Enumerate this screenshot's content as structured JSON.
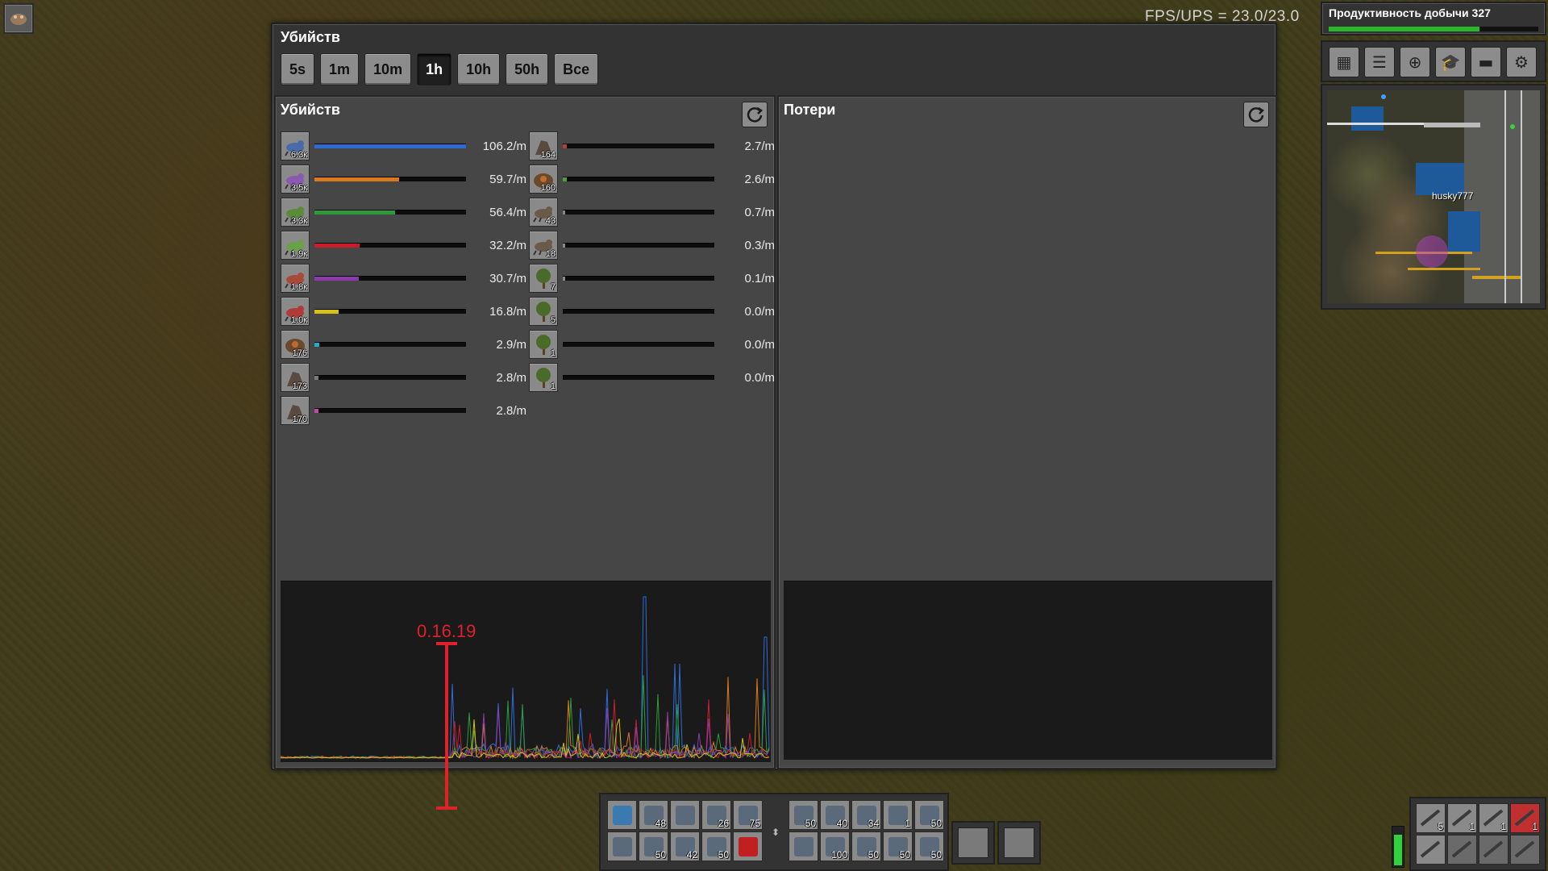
{
  "fps_text": "FPS/UPS = 23.0/23.0",
  "window": {
    "title": "Убийств",
    "tabs": [
      "5s",
      "1m",
      "10m",
      "1h",
      "10h",
      "50h",
      "Все"
    ],
    "active_tab": "1h"
  },
  "kills_panel": {
    "title": "Убийств",
    "left_column": [
      {
        "icon": "small-biter-icon",
        "count": "6.3к",
        "rate": "106.2/m",
        "color": "#2f6bd6",
        "fraction": 1.0
      },
      {
        "icon": "medium-biter-icon",
        "count": "3.5к",
        "rate": "59.7/m",
        "color": "#d9781e",
        "fraction": 0.56
      },
      {
        "icon": "small-spitter-icon",
        "count": "3.3к",
        "rate": "56.4/m",
        "color": "#2e9a3a",
        "fraction": 0.53
      },
      {
        "icon": "medium-spitter-icon",
        "count": "1.9к",
        "rate": "32.2/m",
        "color": "#c81e2a",
        "fraction": 0.3
      },
      {
        "icon": "big-biter-icon",
        "count": "1.8к",
        "rate": "30.7/m",
        "color": "#8a3aa8",
        "fraction": 0.29
      },
      {
        "icon": "big-spitter-icon",
        "count": "1.0к",
        "rate": "16.8/m",
        "color": "#d4c018",
        "fraction": 0.16
      },
      {
        "icon": "biter-spawner-icon",
        "count": "176",
        "rate": "2.9/m",
        "color": "#20b0c8",
        "fraction": 0.03
      },
      {
        "icon": "rock-icon",
        "count": "173",
        "rate": "2.8/m",
        "color": "#7a7a7a",
        "fraction": 0.025
      },
      {
        "icon": "rock-icon",
        "count": "170",
        "rate": "2.8/m",
        "color": "#c04aa8",
        "fraction": 0.025
      }
    ],
    "right_column": [
      {
        "icon": "huge-rock-icon",
        "count": "164",
        "rate": "2.7/m",
        "color": "#b04040",
        "fraction": 0.025
      },
      {
        "icon": "spitter-spawner-icon",
        "count": "160",
        "rate": "2.6/m",
        "color": "#50a030",
        "fraction": 0.025
      },
      {
        "icon": "behemoth-biter-icon",
        "count": "43",
        "rate": "0.7/m",
        "color": "#888888",
        "fraction": 0.007
      },
      {
        "icon": "small-worm-icon",
        "count": "18",
        "rate": "0.3/m",
        "color": "#888888",
        "fraction": 0.003
      },
      {
        "icon": "tree-icon",
        "count": "7",
        "rate": "0.1/m",
        "color": "#888888",
        "fraction": 0.001
      },
      {
        "icon": "dead-tree-icon",
        "count": "5",
        "rate": "0.0/m",
        "color": "#888888",
        "fraction": 0
      },
      {
        "icon": "dry-tree-icon",
        "count": "1",
        "rate": "0.0/m",
        "color": "#888888",
        "fraction": 0
      },
      {
        "icon": "dry-tree-icon",
        "count": "1",
        "rate": "0.0/m",
        "color": "#888888",
        "fraction": 0
      }
    ]
  },
  "losses_panel": {
    "title": "Потери"
  },
  "annotation": {
    "label": "0.16.19",
    "color": "#e0202a"
  },
  "hud": {
    "mining_productivity_label": "Продуктивность добычи 327",
    "mining_progress": 0.72,
    "buttons": [
      "map-icon",
      "production-stats-icon",
      "bonus-icon",
      "research-icon",
      "train-icon",
      "achievements-icon"
    ],
    "player_name": "husky777"
  },
  "quickbar": {
    "row1_a": [
      {
        "icon": "blueprint-icon",
        "count": ""
      },
      {
        "icon": "inserter-icon",
        "count": "48"
      },
      {
        "icon": "lamp-icon",
        "count": ""
      },
      {
        "icon": "assembler-icon",
        "count": "26"
      },
      {
        "icon": "repair-pack-icon",
        "count": "75"
      }
    ],
    "row2_a": [
      {
        "icon": "belt-icon",
        "count": ""
      },
      {
        "icon": "pump-icon",
        "count": "50"
      },
      {
        "icon": "roboport-icon",
        "count": "42"
      },
      {
        "icon": "turret-icon",
        "count": "50"
      },
      {
        "icon": "wall-icon",
        "count": ""
      }
    ],
    "row1_b": [
      {
        "icon": "chest-icon",
        "count": "50"
      },
      {
        "icon": "red-chest-icon",
        "count": "40"
      },
      {
        "icon": "purple-chest-icon",
        "count": "34"
      },
      {
        "icon": "robot-icon",
        "count": "1"
      },
      {
        "icon": "rail-icon",
        "count": "50"
      }
    ],
    "row2_b": [
      {
        "icon": "radar-icon",
        "count": ""
      },
      {
        "icon": "roboport-icon",
        "count": "100"
      },
      {
        "icon": "solar-icon",
        "count": "50"
      },
      {
        "icon": "accumulator-icon",
        "count": "50"
      },
      {
        "icon": "accumulator-icon",
        "count": "50"
      }
    ]
  },
  "weapons": [
    {
      "icon": "gun-icon",
      "count": "5"
    },
    {
      "icon": "shotgun-icon",
      "count": "1"
    },
    {
      "icon": "rocket-launcher-icon",
      "count": "1"
    },
    {
      "icon": "flamethrower-icon",
      "count": "1"
    },
    {
      "icon": "armor-icon",
      "count": ""
    },
    {
      "icon": "ammo-slot-icon",
      "count": ""
    },
    {
      "icon": "ammo-slot-icon",
      "count": ""
    },
    {
      "icon": "ammo-slot-icon",
      "count": ""
    }
  ],
  "colors": {
    "panel_bg": "#464646",
    "window_bg": "#333333",
    "graph_bg": "#1a1a1a",
    "annotation": "#e0202a"
  }
}
